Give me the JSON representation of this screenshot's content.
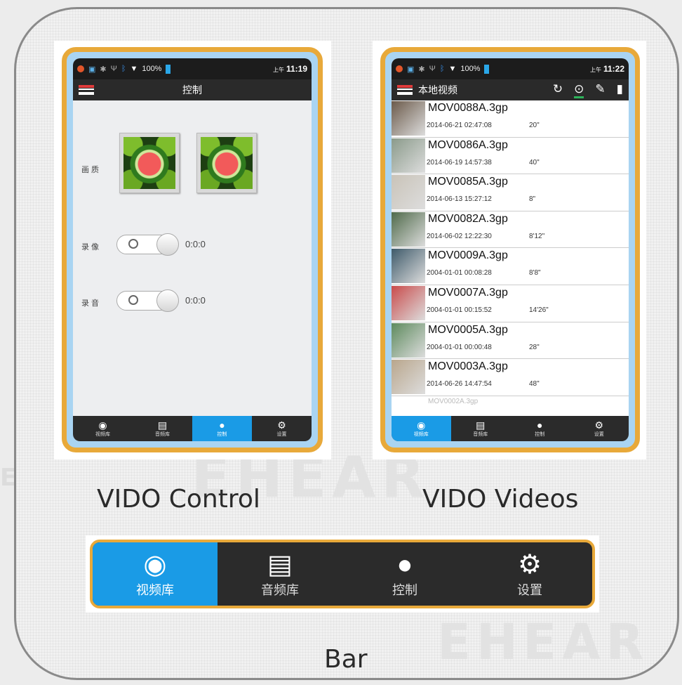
{
  "watermark": "EHEAR",
  "control_screen": {
    "status": {
      "battery": "100%",
      "ampm": "上午",
      "time": "11:19"
    },
    "title": "控制",
    "quality_label": "画 质",
    "record_video_label": "录 像",
    "record_video_value": "0:0:0",
    "record_audio_label": "录 音",
    "record_audio_value": "0:0:0",
    "toggle_symbol": "O"
  },
  "videos_screen": {
    "status": {
      "battery": "100%",
      "ampm": "上午",
      "time": "11:22"
    },
    "title": "本地视频",
    "videos": [
      {
        "name": "MOV0088A.3gp",
        "date": "2014-06-21 02:47:08",
        "duration": "20\""
      },
      {
        "name": "MOV0086A.3gp",
        "date": "2014-06-19 14:57:38",
        "duration": "40\""
      },
      {
        "name": "MOV0085A.3gp",
        "date": "2014-06-13 15:27:12",
        "duration": "8\""
      },
      {
        "name": "MOV0082A.3gp",
        "date": "2014-06-02 12:22:30",
        "duration": "8'12\""
      },
      {
        "name": "MOV0009A.3gp",
        "date": "2004-01-01 00:08:28",
        "duration": "8'8\""
      },
      {
        "name": "MOV0007A.3gp",
        "date": "2004-01-01 00:15:52",
        "duration": "14'26\""
      },
      {
        "name": "MOV0005A.3gp",
        "date": "2004-01-01 00:00:48",
        "duration": "28\""
      },
      {
        "name": "MOV0003A.3gp",
        "date": "2014-06-26 14:47:54",
        "duration": "48\""
      }
    ],
    "partial_item": "MOV0002A.3gp"
  },
  "nav": [
    {
      "label": "视频库",
      "icon": "camera-icon"
    },
    {
      "label": "音频库",
      "icon": "tape-icon"
    },
    {
      "label": "控制",
      "icon": "alarm-icon"
    },
    {
      "label": "设置",
      "icon": "gear-icon"
    }
  ],
  "captions": {
    "control": "VIDO Control",
    "videos": "VIDO Videos",
    "bar": "Bar"
  },
  "colors": {
    "accent": "#1a9be6",
    "frame": "#e8a93a",
    "bar_bg": "#2b2b2b"
  }
}
